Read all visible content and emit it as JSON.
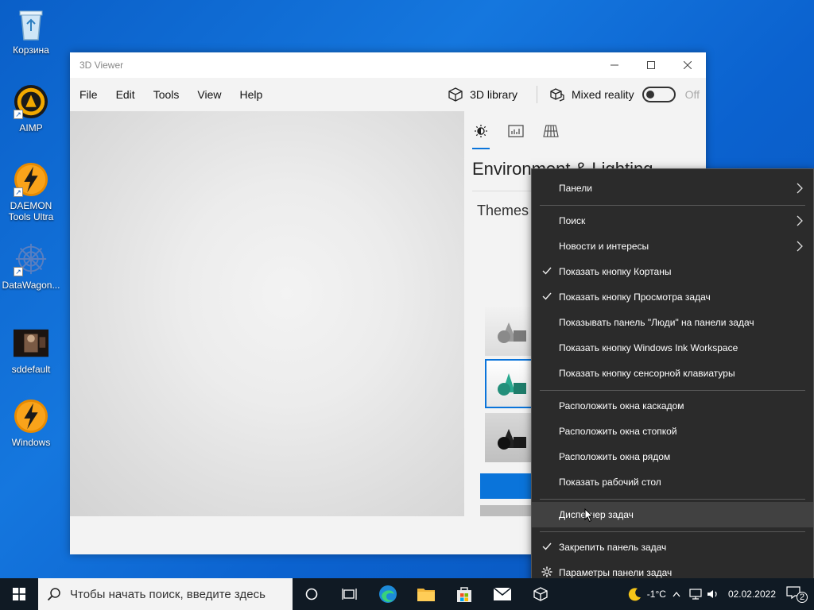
{
  "desktop": {
    "icons": [
      {
        "label": "Корзина"
      },
      {
        "label": "AIMP"
      },
      {
        "label": "DAEMON Tools Ultra"
      },
      {
        "label": "DataWagon..."
      },
      {
        "label": "sddefault"
      },
      {
        "label": "Windows"
      }
    ]
  },
  "window": {
    "title": "3D Viewer",
    "menu": [
      "File",
      "Edit",
      "Tools",
      "View",
      "Help"
    ],
    "library_label": "3D library",
    "mixed_reality_label": "Mixed reality",
    "toggle_state": "Off",
    "panel": {
      "title": "Environment & Lighting",
      "themes_label": "Themes"
    }
  },
  "context_menu": {
    "items": [
      {
        "label": "Панели",
        "submenu": true
      },
      {
        "label": "Поиск",
        "submenu": true
      },
      {
        "label": "Новости и интересы",
        "submenu": true
      },
      {
        "label": "Показать кнопку Кортаны",
        "checked": true
      },
      {
        "label": "Показать кнопку Просмотра задач",
        "checked": true
      },
      {
        "label": "Показывать панель \"Люди\" на панели задач"
      },
      {
        "label": "Показать кнопку Windows Ink Workspace"
      },
      {
        "label": "Показать кнопку сенсорной клавиатуры"
      },
      {
        "label": "Расположить окна каскадом"
      },
      {
        "label": "Расположить окна стопкой"
      },
      {
        "label": "Расположить окна рядом"
      },
      {
        "label": "Показать рабочий стол"
      },
      {
        "label": "Диспетчер задач"
      },
      {
        "label": "Закрепить панель задач",
        "checked": true
      },
      {
        "label": "Параметры панели задач",
        "icon": "gear-icon"
      }
    ]
  },
  "taskbar": {
    "search_placeholder": "Чтобы начать поиск, введите здесь",
    "weather": "-1°C",
    "date": "02.02.2022",
    "notification_count": "2"
  },
  "colors": {
    "accent": "#0a74da",
    "menu_bg": "#2b2b2b",
    "taskbar_bg": "#101a24"
  }
}
